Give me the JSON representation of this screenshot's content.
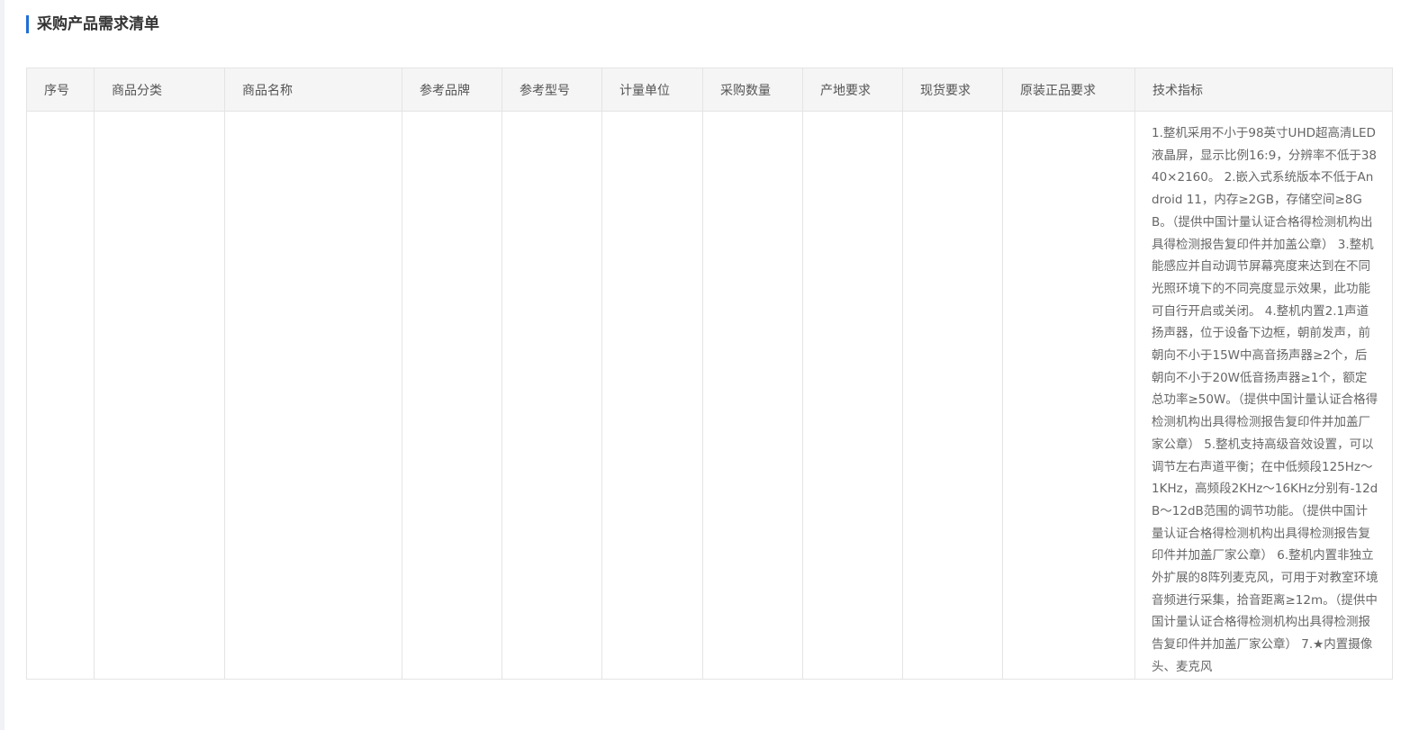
{
  "section": {
    "title": "采购产品需求清单"
  },
  "table": {
    "headers": [
      "序号",
      "商品分类",
      "商品名称",
      "参考品牌",
      "参考型号",
      "计量单位",
      "采购数量",
      "产地要求",
      "现货要求",
      "原装正品要求",
      "技术指标"
    ],
    "rows": [
      {
        "index": "",
        "category": "",
        "name": "",
        "brand": "",
        "model": "",
        "unit": "",
        "quantity": "",
        "origin": "",
        "stock": "",
        "genuine": "",
        "spec": "1.整机采用不小于98英寸UHD超高清LED液晶屏，显示比例16:9，分辨率不低于3840×2160。 2.嵌入式系统版本不低于Android 11，内存≥2GB，存储空间≥8GB。（提供中国计量认证合格得检测机构出具得检测报告复印件并加盖公章） 3.整机能感应并自动调节屏幕亮度来达到在不同光照环境下的不同亮度显示效果，此功能可自行开启或关闭。 4.整机内置2.1声道扬声器，位于设备下边框，朝前发声，前朝向不小于15W中高音扬声器≥2个，后朝向不小于20W低音扬声器≥1个，额定总功率≥50W。（提供中国计量认证合格得检测机构出具得检测报告复印件并加盖厂家公章） 5.整机支持高级音效设置，可以调节左右声道平衡；在中低频段125Hz～1KHz，高频段2KHz～16KHz分别有-12dB～12dB范围的调节功能。（提供中国计量认证合格得检测机构出具得检测报告复印件并加盖厂家公章） 6.整机内置非独立外扩展的8阵列麦克风，可用于对教室环境音频进行采集，拾音距离≥12m。（提供中国计量认证合格得检测机构出具得检测报告复印件并加盖厂家公章） 7.★内置摄像头、麦克风"
      }
    ]
  }
}
